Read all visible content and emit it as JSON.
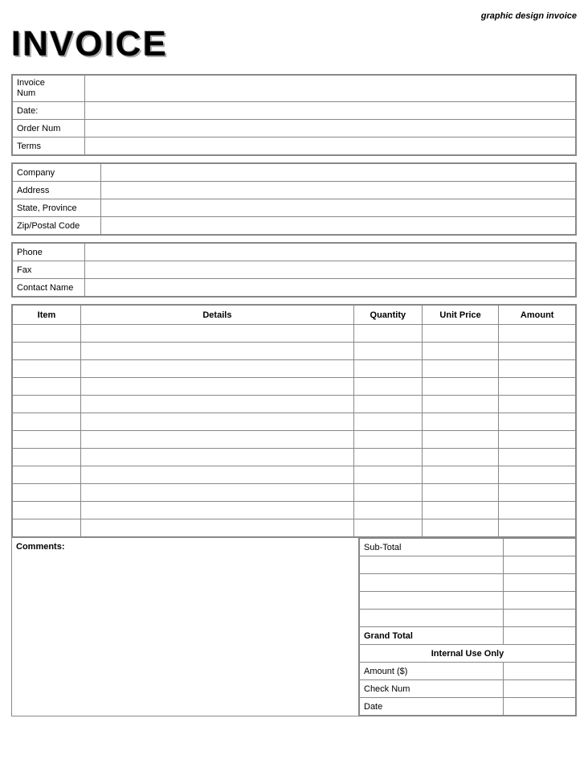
{
  "header": {
    "top_label": "graphic design invoice",
    "title": "INVOICE"
  },
  "invoice_info": {
    "rows": [
      {
        "label": "Invoice\nNum",
        "value": ""
      },
      {
        "label": "Date:",
        "value": ""
      },
      {
        "label": "Order Num",
        "value": ""
      },
      {
        "label": "Terms",
        "value": ""
      }
    ]
  },
  "address_info": {
    "rows": [
      {
        "label": "Company",
        "value": ""
      },
      {
        "label": "Address",
        "value": ""
      },
      {
        "label": "State, Province",
        "value": ""
      },
      {
        "label": "Zip/Postal Code",
        "value": ""
      }
    ]
  },
  "contact_info": {
    "rows": [
      {
        "label": "Phone",
        "value": ""
      },
      {
        "label": "Fax",
        "value": ""
      },
      {
        "label": "Contact Name",
        "value": ""
      }
    ]
  },
  "items_table": {
    "headers": [
      "Item",
      "Details",
      "Quantity",
      "Unit Price",
      "Amount"
    ],
    "rows": 12
  },
  "comments": {
    "label": "Comments:"
  },
  "totals": {
    "sub_total_label": "Sub-Total",
    "sub_total_value": "",
    "extra_rows": [
      "",
      "",
      "",
      ""
    ],
    "grand_total_label": "Grand Total",
    "grand_total_value": "",
    "internal_use_label": "Internal Use Only",
    "amount_label": "Amount ($)",
    "amount_value": "",
    "check_num_label": "Check Num",
    "check_num_value": "",
    "date_label": "Date",
    "date_value": ""
  }
}
